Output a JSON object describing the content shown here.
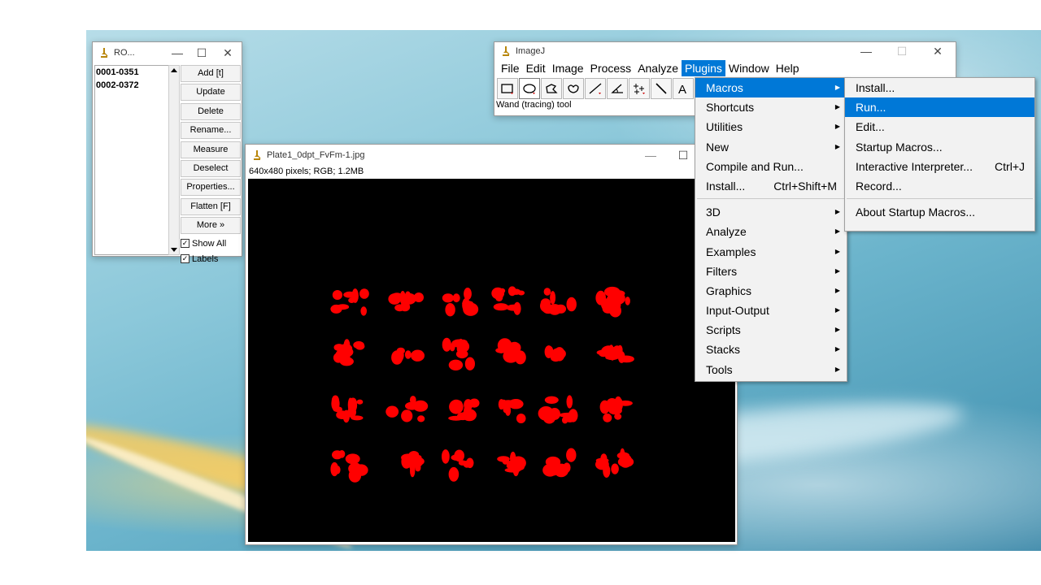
{
  "roi_manager": {
    "title": "RO...",
    "list": [
      "0001-0351",
      "0002-0372"
    ],
    "buttons": [
      "Add [t]",
      "Update",
      "Delete",
      "Rename...",
      "Measure",
      "Deselect",
      "Properties...",
      "Flatten [F]",
      "More »"
    ],
    "show_all": "Show All",
    "labels": "Labels",
    "show_all_checked": true,
    "labels_checked": true
  },
  "imagej": {
    "title": "ImageJ",
    "menus": [
      "File",
      "Edit",
      "Image",
      "Process",
      "Analyze",
      "Plugins",
      "Window",
      "Help"
    ],
    "active_menu": "Plugins",
    "tools": [
      "rectangle-tool",
      "oval-tool",
      "polygon-tool",
      "freehand-tool",
      "line-tool",
      "angle-tool",
      "multipoint-tool",
      "wand-tool",
      "text-tool"
    ],
    "status": "Wand (tracing) tool"
  },
  "image_window": {
    "title": "Plate1_0dpt_FvFm-1.jpg",
    "info": "640x480 pixels; RGB; 1.2MB"
  },
  "plugins_menu": {
    "items": [
      {
        "label": "Macros",
        "arrow": true,
        "highlighted": true
      },
      {
        "label": "Shortcuts",
        "arrow": true
      },
      {
        "label": "Utilities",
        "arrow": true
      },
      {
        "label": "New",
        "arrow": true
      },
      {
        "label": "Compile and Run..."
      },
      {
        "label": "Install...",
        "shortcut": "Ctrl+Shift+M"
      },
      {
        "separator": true
      },
      {
        "label": "3D",
        "arrow": true
      },
      {
        "label": "Analyze",
        "arrow": true
      },
      {
        "label": "Examples",
        "arrow": true
      },
      {
        "label": "Filters",
        "arrow": true
      },
      {
        "label": "Graphics",
        "arrow": true
      },
      {
        "label": "Input-Output",
        "arrow": true
      },
      {
        "label": "Scripts",
        "arrow": true
      },
      {
        "label": "Stacks",
        "arrow": true
      },
      {
        "label": "Tools",
        "arrow": true
      }
    ]
  },
  "macros_menu": {
    "items": [
      {
        "label": "Install..."
      },
      {
        "label": "Run...",
        "highlighted": true
      },
      {
        "label": "Edit..."
      },
      {
        "label": "Startup Macros..."
      },
      {
        "label": "Interactive Interpreter...",
        "shortcut": "Ctrl+J"
      },
      {
        "label": "Record..."
      },
      {
        "separator": true
      },
      {
        "label": "About Startup Macros..."
      }
    ]
  },
  "window_controls": {
    "minimize": "—",
    "maximize": "☐",
    "close": "✕"
  },
  "colors": {
    "accent": "#0078d7",
    "blob": "#ff0000",
    "canvas": "#000000"
  }
}
